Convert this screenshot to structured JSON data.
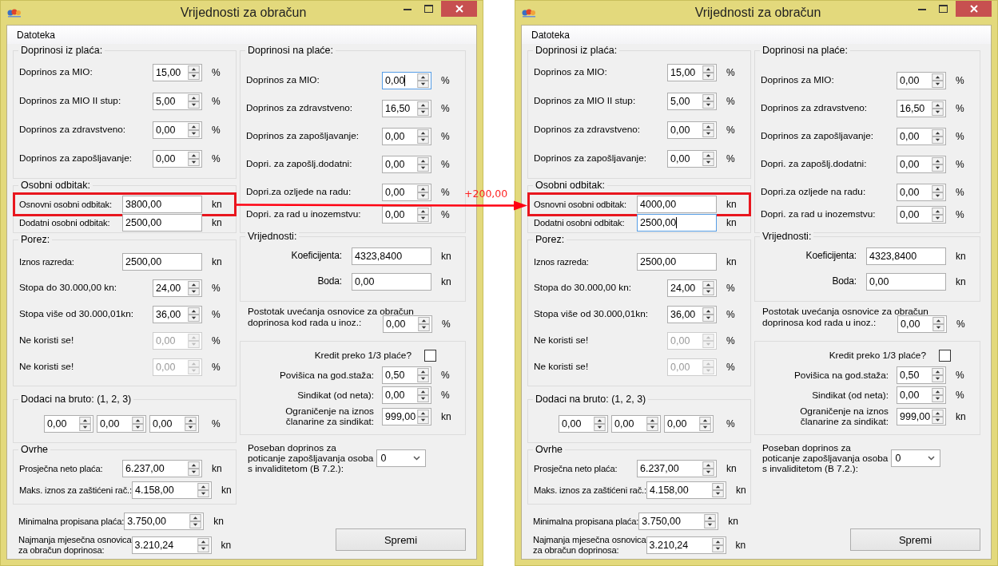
{
  "windows": [
    {
      "title": "Vrijednosti za obračun",
      "menu": [
        {
          "label": "Datoteka"
        }
      ],
      "left": [
        {
          "kind": "group-spaced",
          "legend": "Doprinosi iz plaća:",
          "rows": [
            {
              "kind": "spin",
              "label": "Doprinos za MIO:",
              "value": "15,00",
              "unit": "%"
            },
            {
              "kind": "spin",
              "label": "Doprinos za MIO II stup:",
              "value": "5,00",
              "unit": "%"
            },
            {
              "kind": "spin",
              "label": "Doprinos za zdravstveno:",
              "value": "0,00",
              "unit": "%"
            },
            {
              "kind": "spin",
              "label": "Doprinos za zapošljavanje:",
              "value": "0,00",
              "unit": "%"
            }
          ]
        },
        {
          "kind": "group",
          "legend": "Osobni odbitak:",
          "rows": [
            {
              "kind": "text",
              "label": "Osnovni osobni odbitak:",
              "value": "3800,00",
              "unit": "kn",
              "highlighted": true,
              "focused": false
            },
            {
              "kind": "text",
              "label": "Dodatni osobni odbitak:",
              "value": "2500,00",
              "unit": "kn",
              "highlighted": false,
              "focused": false
            }
          ]
        },
        {
          "kind": "group-porez",
          "legend": "Porez:",
          "rows": [
            {
              "kind": "text",
              "label": "Iznos razreda:",
              "value": "2500,00",
              "unit": "kn",
              "disabled": false
            },
            {
              "kind": "spin",
              "label": "Stopa do 30.000,00 kn:",
              "value": "24,00",
              "unit": "%",
              "disabled": false
            },
            {
              "kind": "spin",
              "label": "Stopa više od 30.000,01kn:",
              "value": "36,00",
              "unit": "%",
              "disabled": false
            },
            {
              "kind": "spin",
              "label": "Ne koristi se!",
              "value": "0,00",
              "unit": "%",
              "disabled": true
            },
            {
              "kind": "spin",
              "label": "Ne koristi se!",
              "value": "0,00",
              "unit": "%",
              "disabled": true
            }
          ]
        },
        {
          "kind": "group",
          "legend": "Dodaci na bruto: (1, 2, 3)",
          "rows": [
            {
              "kind": "triple",
              "values": [
                "0,00",
                "0,00",
                "0,00"
              ],
              "unit": "%"
            }
          ]
        },
        {
          "kind": "group-tight",
          "legend": "Ovrhe",
          "rows": [
            {
              "kind": "wide-spin",
              "label": "Prosječna neto plaća:",
              "value": "6.237,00",
              "unit": "kn"
            },
            {
              "kind": "wide-spin",
              "label": "Maks. iznos za zaštićeni rač.:",
              "value": "4.158,00",
              "unit": "kn"
            }
          ]
        },
        {
          "kind": "plain",
          "rows": [
            {
              "kind": "wide-spin",
              "label": "Minimalna propisana plaća:",
              "value": "3.750,00",
              "unit": "kn"
            },
            {
              "kind": "wide-spin",
              "label": "Najmanja mjesečna osnovica\nza obračun doprinosa:",
              "value": "3.210,24",
              "unit": "kn"
            }
          ]
        }
      ],
      "right": [
        {
          "kind": "group-spaced2",
          "legend": "Doprinosi na plaće:",
          "rows": [
            {
              "kind": "spin",
              "label": "Doprinos za MIO:",
              "value": "0,00",
              "unit": "%",
              "focused": true
            },
            {
              "kind": "spin",
              "label": "Doprinos za zdravstveno:",
              "value": "16,50",
              "unit": "%",
              "focused": false
            },
            {
              "kind": "spin",
              "label": "Doprinos za zapošljavanje:",
              "value": "0,00",
              "unit": "%",
              "focused": false
            },
            {
              "kind": "spin",
              "label": "Dopri. za zapošlj.dodatni:",
              "value": "0,00",
              "unit": "%",
              "focused": false
            },
            {
              "kind": "spin",
              "label": "Dopri.za ozljede na radu:",
              "value": "0,00",
              "unit": "%",
              "focused": false
            },
            {
              "kind": "spin",
              "label": "Dopri. za rad u inozemstvu:",
              "value": "0,00",
              "unit": "%",
              "focused": false
            }
          ]
        },
        {
          "kind": "group-right",
          "legend": "Vrijednosti:",
          "rows": [
            {
              "kind": "text",
              "label": "Koeficijenta:",
              "value": "4323,8400",
              "unit": "kn"
            },
            {
              "kind": "text",
              "label": "Boda:",
              "value": "0,00",
              "unit": "kn"
            }
          ]
        },
        {
          "kind": "plain",
          "rows": [
            {
              "kind": "caption",
              "label": "Postotak uvećanja osnovice za obračun"
            },
            {
              "kind": "spin",
              "label": "doprinosa kod rada u inoz.:",
              "value": "0,00",
              "unit": "%"
            }
          ]
        },
        {
          "kind": "panel",
          "rows": [
            {
              "kind": "checkbox",
              "label": "Kredit preko 1/3 plaće?",
              "checked": false
            },
            {
              "kind": "spin",
              "label": "Povišica na god.staža:",
              "value": "0,50",
              "unit": "%"
            },
            {
              "kind": "spin",
              "label": "Sindikat (od neta):",
              "value": "0,00",
              "unit": "%"
            },
            {
              "kind": "spin",
              "label": "Ograničenje na iznos\nčlanarine za sindikat:",
              "value": "999,00",
              "unit": "kn"
            }
          ]
        },
        {
          "kind": "plain",
          "rows": [
            {
              "kind": "combo",
              "label": "Poseban doprinos za\npoticanje zapošljavanja osoba\ns invaliditetom (B 7.2.):",
              "value": "0"
            }
          ]
        }
      ],
      "save_button": "Spremi"
    },
    {
      "title": "Vrijednosti za obračun",
      "menu": [
        {
          "label": "Datoteka"
        }
      ],
      "left": [
        {
          "kind": "group-spaced",
          "legend": "Doprinosi iz plaća:",
          "rows": [
            {
              "kind": "spin",
              "label": "Doprinos za MIO:",
              "value": "15,00",
              "unit": "%"
            },
            {
              "kind": "spin",
              "label": "Doprinos za MIO II stup:",
              "value": "5,00",
              "unit": "%"
            },
            {
              "kind": "spin",
              "label": "Doprinos za zdravstveno:",
              "value": "0,00",
              "unit": "%"
            },
            {
              "kind": "spin",
              "label": "Doprinos za zapošljavanje:",
              "value": "0,00",
              "unit": "%"
            }
          ]
        },
        {
          "kind": "group",
          "legend": "Osobni odbitak:",
          "rows": [
            {
              "kind": "text",
              "label": "Osnovni osobni odbitak:",
              "value": "4000,00",
              "unit": "kn",
              "highlighted": true,
              "focused": false
            },
            {
              "kind": "text",
              "label": "Dodatni osobni odbitak:",
              "value": "2500,00",
              "unit": "kn",
              "highlighted": false,
              "focused": true
            }
          ]
        },
        {
          "kind": "group-porez",
          "legend": "Porez:",
          "rows": [
            {
              "kind": "text",
              "label": "Iznos razreda:",
              "value": "2500,00",
              "unit": "kn",
              "disabled": false
            },
            {
              "kind": "spin",
              "label": "Stopa do 30.000,00 kn:",
              "value": "24,00",
              "unit": "%",
              "disabled": false
            },
            {
              "kind": "spin",
              "label": "Stopa više od 30.000,01kn:",
              "value": "36,00",
              "unit": "%",
              "disabled": false
            },
            {
              "kind": "spin",
              "label": "Ne koristi se!",
              "value": "0,00",
              "unit": "%",
              "disabled": true
            },
            {
              "kind": "spin",
              "label": "Ne koristi se!",
              "value": "0,00",
              "unit": "%",
              "disabled": true
            }
          ]
        },
        {
          "kind": "group",
          "legend": "Dodaci na bruto: (1, 2, 3)",
          "rows": [
            {
              "kind": "triple",
              "values": [
                "0,00",
                "0,00",
                "0,00"
              ],
              "unit": "%"
            }
          ]
        },
        {
          "kind": "group-tight",
          "legend": "Ovrhe",
          "rows": [
            {
              "kind": "wide-spin",
              "label": "Prosječna neto plaća:",
              "value": "6.237,00",
              "unit": "kn"
            },
            {
              "kind": "wide-spin",
              "label": "Maks. iznos za zaštićeni rač.:",
              "value": "4.158,00",
              "unit": "kn"
            }
          ]
        },
        {
          "kind": "plain",
          "rows": [
            {
              "kind": "wide-spin",
              "label": "Minimalna propisana plaća:",
              "value": "3.750,00",
              "unit": "kn"
            },
            {
              "kind": "wide-spin",
              "label": "Najmanja mjesečna osnovica\nza obračun doprinosa:",
              "value": "3.210,24",
              "unit": "kn"
            }
          ]
        }
      ],
      "right": [
        {
          "kind": "group-spaced2",
          "legend": "Doprinosi na plaće:",
          "rows": [
            {
              "kind": "spin",
              "label": "Doprinos za MIO:",
              "value": "0,00",
              "unit": "%",
              "focused": false
            },
            {
              "kind": "spin",
              "label": "Doprinos za zdravstveno:",
              "value": "16,50",
              "unit": "%",
              "focused": false
            },
            {
              "kind": "spin",
              "label": "Doprinos za zapošljavanje:",
              "value": "0,00",
              "unit": "%",
              "focused": false
            },
            {
              "kind": "spin",
              "label": "Dopri. za zapošlj.dodatni:",
              "value": "0,00",
              "unit": "%",
              "focused": false
            },
            {
              "kind": "spin",
              "label": "Dopri.za ozljede na radu:",
              "value": "0,00",
              "unit": "%",
              "focused": false
            },
            {
              "kind": "spin",
              "label": "Dopri. za rad u inozemstvu:",
              "value": "0,00",
              "unit": "%",
              "focused": false
            }
          ]
        },
        {
          "kind": "group-right",
          "legend": "Vrijednosti:",
          "rows": [
            {
              "kind": "text",
              "label": "Koeficijenta:",
              "value": "4323,8400",
              "unit": "kn"
            },
            {
              "kind": "text",
              "label": "Boda:",
              "value": "0,00",
              "unit": "kn"
            }
          ]
        },
        {
          "kind": "plain",
          "rows": [
            {
              "kind": "caption",
              "label": "Postotak uvećanja osnovice za obračun"
            },
            {
              "kind": "spin",
              "label": "doprinosa kod rada u inoz.:",
              "value": "0,00",
              "unit": "%"
            }
          ]
        },
        {
          "kind": "panel",
          "rows": [
            {
              "kind": "checkbox",
              "label": "Kredit preko 1/3 plaće?",
              "checked": false
            },
            {
              "kind": "spin",
              "label": "Povišica na god.staža:",
              "value": "0,50",
              "unit": "%"
            },
            {
              "kind": "spin",
              "label": "Sindikat (od neta):",
              "value": "0,00",
              "unit": "%"
            },
            {
              "kind": "spin",
              "label": "Ograničenje na iznos\nčlanarine za sindikat:",
              "value": "999,00",
              "unit": "kn"
            }
          ]
        },
        {
          "kind": "plain",
          "rows": [
            {
              "kind": "combo",
              "label": "Poseban doprinos za\npoticanje zapošljavanja osoba\ns invaliditetom (B 7.2.):",
              "value": "0"
            }
          ]
        }
      ],
      "save_button": "Spremi"
    }
  ],
  "annotation": {
    "label": "+200,00"
  }
}
